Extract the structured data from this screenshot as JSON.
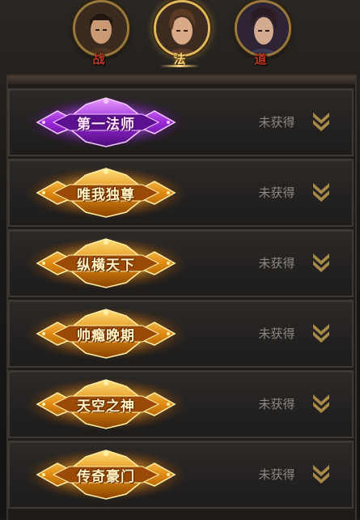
{
  "class_tabs": [
    {
      "label": "战",
      "active": false
    },
    {
      "label": "法",
      "active": true
    },
    {
      "label": "道",
      "active": false
    }
  ],
  "titles": [
    {
      "name": "第一法师",
      "style": "purple",
      "status": "未获得",
      "expand_icon": "double-chevron-down-icon"
    },
    {
      "name": "唯我独尊",
      "style": "gold",
      "status": "未获得",
      "expand_icon": "double-chevron-down-icon"
    },
    {
      "name": "纵横天下",
      "style": "gold",
      "status": "未获得",
      "expand_icon": "double-chevron-down-icon"
    },
    {
      "name": "帅瘾晚期",
      "style": "gold",
      "status": "未获得",
      "expand_icon": "double-chevron-down-icon"
    },
    {
      "name": "天空之神",
      "style": "gold",
      "status": "未获得",
      "expand_icon": "double-chevron-down-icon"
    },
    {
      "name": "传奇豪门",
      "style": "gold",
      "status": "未获得",
      "expand_icon": "double-chevron-down-icon"
    }
  ],
  "colors": {
    "gold_badge": "#e8a21e",
    "purple_badge": "#a43ee0",
    "status_text": "#8c8882",
    "chevron": "#a88a48"
  }
}
